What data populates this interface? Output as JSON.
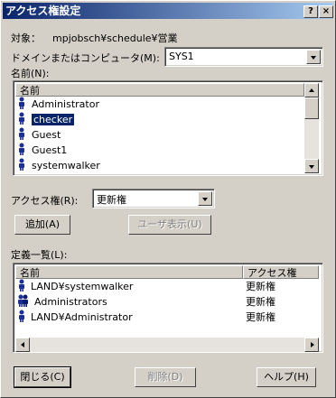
{
  "window": {
    "title": "アクセス権設定",
    "help_button": "?",
    "close_button": "×"
  },
  "target": {
    "label": "対象：",
    "value": "mpjobsch¥schedule¥営業"
  },
  "domain": {
    "label": "ドメインまたはコンピュータ(M):",
    "value": "SYS1"
  },
  "names": {
    "label": "名前(N):",
    "column": "名前",
    "items": [
      {
        "name": "Administrator",
        "selected": false
      },
      {
        "name": "checker",
        "selected": true
      },
      {
        "name": "Guest",
        "selected": false
      },
      {
        "name": "Guest1",
        "selected": false
      },
      {
        "name": "systemwalker",
        "selected": false
      }
    ]
  },
  "access": {
    "label": "アクセス権(R):",
    "value": "更新権"
  },
  "buttons": {
    "add": "追加(A)",
    "show_users": "ユーザ表示(U)",
    "close": "閉じる(C)",
    "delete": "削除(D)",
    "help": "ヘルプ(H)"
  },
  "definitions": {
    "label": "定義一覧(L):",
    "col_name": "名前",
    "col_access": "アクセス権",
    "rows": [
      {
        "name": "LAND¥systemwalker",
        "access": "更新権",
        "icon": "user-icon"
      },
      {
        "name": "Administrators",
        "access": "更新権",
        "icon": "group-icon"
      },
      {
        "name": "LAND¥Administrator",
        "access": "更新権",
        "icon": "user-icon"
      }
    ]
  }
}
